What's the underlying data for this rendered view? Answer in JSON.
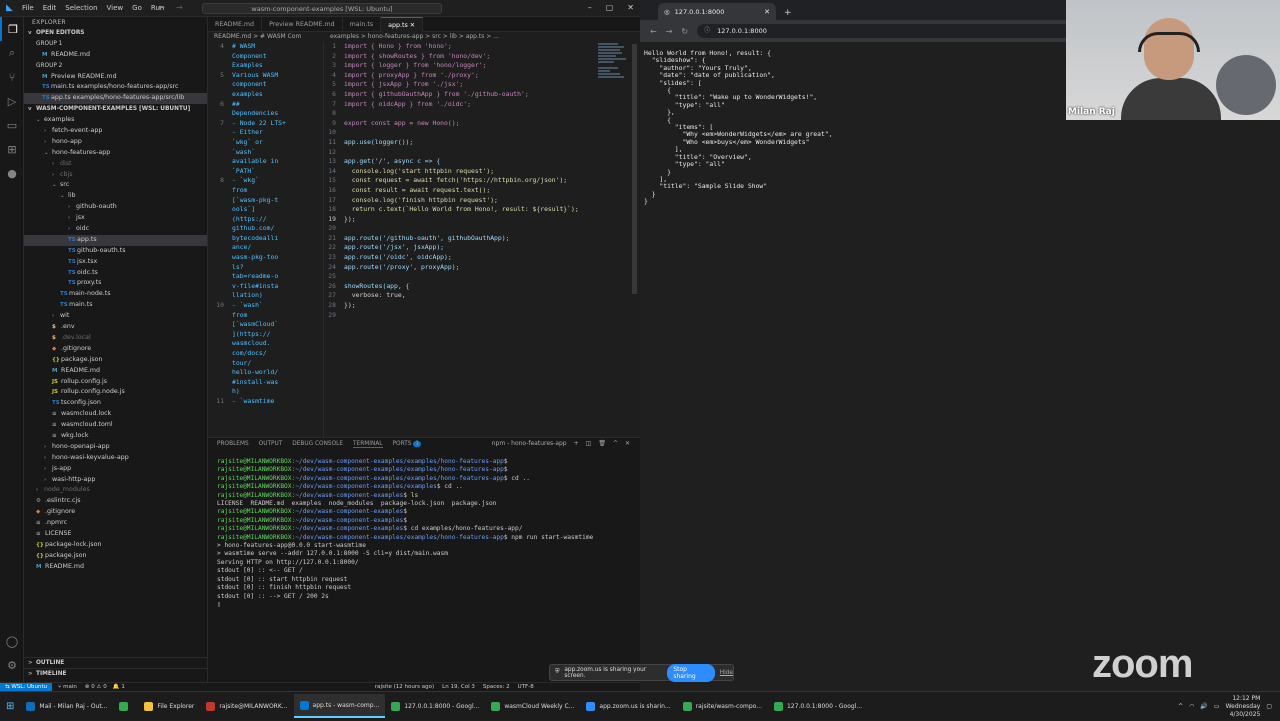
{
  "vscode": {
    "menu": [
      "File",
      "Edit",
      "Selection",
      "View",
      "Go",
      "Run"
    ],
    "command_center": "wasm-component-examples [WSL: Ubuntu]",
    "explorer": {
      "title": "EXPLORER",
      "open_editors": "OPEN EDITORS",
      "group1": "GROUP 1",
      "group1_items": [
        "README.md"
      ],
      "group2": "GROUP 2",
      "group2_items": [
        "Preview README.md",
        "main.ts examples/hono-features-app/src",
        "app.ts examples/hono-features-app/src/lib"
      ],
      "root": "WASM-COMPONENT-EXAMPLES [WSL: UBUNTU]",
      "tree": [
        {
          "indent": 1,
          "twisty": "v",
          "label": "examples"
        },
        {
          "indent": 2,
          "twisty": ">",
          "label": "fetch-event-app"
        },
        {
          "indent": 2,
          "twisty": ">",
          "label": "hono-app"
        },
        {
          "indent": 2,
          "twisty": "v",
          "label": "hono-features-app"
        },
        {
          "indent": 3,
          "twisty": ">",
          "label": "dist",
          "dim": true
        },
        {
          "indent": 3,
          "twisty": ">",
          "label": "cbjs",
          "dim": true
        },
        {
          "indent": 3,
          "twisty": "v",
          "label": "src"
        },
        {
          "indent": 4,
          "twisty": "v",
          "label": "lib"
        },
        {
          "indent": 5,
          "twisty": ">",
          "label": "github-oauth"
        },
        {
          "indent": 5,
          "twisty": ">",
          "label": "jsx"
        },
        {
          "indent": 5,
          "twisty": ">",
          "label": "oidc"
        },
        {
          "indent": 5,
          "file": "TS",
          "label": "app.ts",
          "selected": true
        },
        {
          "indent": 5,
          "file": "TS",
          "label": "github-oauth.ts"
        },
        {
          "indent": 5,
          "file": "TS",
          "label": "jsx.tsx"
        },
        {
          "indent": 5,
          "file": "TS",
          "label": "oidc.ts"
        },
        {
          "indent": 5,
          "file": "TS",
          "label": "proxy.ts"
        },
        {
          "indent": 4,
          "file": "TS",
          "label": "main-node.ts"
        },
        {
          "indent": 4,
          "file": "TS",
          "label": "main.ts"
        },
        {
          "indent": 3,
          "twisty": ">",
          "label": "wit"
        },
        {
          "indent": 3,
          "file": "$",
          "label": ".env"
        },
        {
          "indent": 3,
          "file": "$",
          "label": ".dev.local",
          "dim": true
        },
        {
          "indent": 3,
          "file": "◆",
          "label": ".gitignore"
        },
        {
          "indent": 3,
          "file": "{}",
          "label": "package.json"
        },
        {
          "indent": 3,
          "file": "M",
          "label": "README.md"
        },
        {
          "indent": 3,
          "file": "JS",
          "label": "rollup.config.js"
        },
        {
          "indent": 3,
          "file": "JS",
          "label": "rollup.config.node.js"
        },
        {
          "indent": 3,
          "file": "TS",
          "label": "tsconfig.json"
        },
        {
          "indent": 3,
          "file": "≡",
          "label": "wasmcloud.lock"
        },
        {
          "indent": 3,
          "file": "≡",
          "label": "wasmcloud.toml"
        },
        {
          "indent": 3,
          "file": "≡",
          "label": "wkg.lock"
        },
        {
          "indent": 2,
          "twisty": ">",
          "label": "hono-openapi-app"
        },
        {
          "indent": 2,
          "twisty": ">",
          "label": "hono-wasi-keyvalue-app"
        },
        {
          "indent": 2,
          "twisty": ">",
          "label": "js-app"
        },
        {
          "indent": 2,
          "twisty": ">",
          "label": "wasi-http-app"
        },
        {
          "indent": 1,
          "twisty": ">",
          "label": "node_modules",
          "dim": true
        },
        {
          "indent": 1,
          "file": "⚙",
          "label": ".eslintrc.cjs"
        },
        {
          "indent": 1,
          "file": "◆",
          "label": ".gitignore"
        },
        {
          "indent": 1,
          "file": "≡",
          "label": ".npmrc"
        },
        {
          "indent": 1,
          "file": "≡",
          "label": "LICENSE"
        },
        {
          "indent": 1,
          "file": "{}",
          "label": "package-lock.json"
        },
        {
          "indent": 1,
          "file": "{}",
          "label": "package.json"
        },
        {
          "indent": 1,
          "file": "M",
          "label": "README.md"
        }
      ],
      "outline": "OUTLINE",
      "timeline": "TIMELINE"
    },
    "tabs": [
      "README.md",
      "Preview README.md",
      "main.ts",
      "app.ts"
    ],
    "breadcrumb_left": "README.md > # WASM Com",
    "breadcrumb_right": "examples > hono-features-app > src > lib > app.ts > ...",
    "preview_lines": [
      {
        "ln": "4",
        "tx": "# WASM"
      },
      {
        "ln": "",
        "tx": "Component"
      },
      {
        "ln": "",
        "tx": "Examples"
      },
      {
        "ln": "",
        "tx": ""
      },
      {
        "ln": "5",
        "tx": "Various WASM"
      },
      {
        "ln": "",
        "tx": "component"
      },
      {
        "ln": "",
        "tx": "examples"
      },
      {
        "ln": "",
        "tx": ""
      },
      {
        "ln": "6",
        "tx": "##"
      },
      {
        "ln": "",
        "tx": "Dependencies"
      },
      {
        "ln": "",
        "tx": ""
      },
      {
        "ln": "7",
        "tx": "- Node 22 LTS+"
      },
      {
        "ln": "",
        "tx": "- Either"
      },
      {
        "ln": "",
        "tx": "`wkg` or"
      },
      {
        "ln": "",
        "tx": "`wash`"
      },
      {
        "ln": "",
        "tx": "available in"
      },
      {
        "ln": "",
        "tx": "`PATH`"
      },
      {
        "ln": "8",
        "tx": "  - `wkg`"
      },
      {
        "ln": "",
        "tx": "  from"
      },
      {
        "ln": "",
        "tx": "  [`wasm-pkg-t"
      },
      {
        "ln": "",
        "tx": "  ools`]"
      },
      {
        "ln": "",
        "tx": "  (https://"
      },
      {
        "ln": "",
        "tx": "  github.com/"
      },
      {
        "ln": "",
        "tx": "  bytecodealli"
      },
      {
        "ln": "",
        "tx": "  ance/"
      },
      {
        "ln": "",
        "tx": "  wasm-pkg-too"
      },
      {
        "ln": "",
        "tx": "  ls?"
      },
      {
        "ln": "",
        "tx": "  tab=readme-o"
      },
      {
        "ln": "",
        "tx": "  v-file#insta"
      },
      {
        "ln": "",
        "tx": "  llation)"
      },
      {
        "ln": "10",
        "tx": "  - `wash`"
      },
      {
        "ln": "",
        "tx": "  from"
      },
      {
        "ln": "",
        "tx": "  [`wasmCloud`"
      },
      {
        "ln": "",
        "tx": "  ](https://"
      },
      {
        "ln": "",
        "tx": "  wasmcloud."
      },
      {
        "ln": "",
        "tx": "  com/docs/"
      },
      {
        "ln": "",
        "tx": "  tour/"
      },
      {
        "ln": "",
        "tx": "  hello-world/"
      },
      {
        "ln": "",
        "tx": "  #install-was"
      },
      {
        "ln": "",
        "tx": "  h)"
      },
      {
        "ln": "11",
        "tx": "  - `wasmtime"
      }
    ],
    "code_lines": [
      {
        "ln": "1",
        "tx": "import { Hono } from 'hono';"
      },
      {
        "ln": "2",
        "tx": "import { showRoutes } from 'hono/dev';"
      },
      {
        "ln": "3",
        "tx": "import { logger } from 'hono/logger';"
      },
      {
        "ln": "4",
        "tx": "import { proxyApp } from './proxy';"
      },
      {
        "ln": "5",
        "tx": "import { jsxApp } from './jsx';"
      },
      {
        "ln": "6",
        "tx": "import { githubOauthApp } from './github-oauth';"
      },
      {
        "ln": "7",
        "tx": "import { oidcApp } from './oidc';"
      },
      {
        "ln": "8",
        "tx": ""
      },
      {
        "ln": "9",
        "tx": "export const app = new Hono();"
      },
      {
        "ln": "10",
        "tx": ""
      },
      {
        "ln": "11",
        "tx": "app.use(logger());"
      },
      {
        "ln": "12",
        "tx": ""
      },
      {
        "ln": "13",
        "tx": "app.get('/', async c => {"
      },
      {
        "ln": "14",
        "tx": "  console.log('start httpbin request');"
      },
      {
        "ln": "15",
        "tx": "  const request = await fetch('https://httpbin.org/json');"
      },
      {
        "ln": "16",
        "tx": "  const result = await request.text();"
      },
      {
        "ln": "17",
        "tx": "  console.log('finish httpbin request');"
      },
      {
        "ln": "18",
        "tx": "  return c.text(`Hello World from Hono!, result: ${result}`);"
      },
      {
        "ln": "19",
        "tx": "});"
      },
      {
        "ln": "20",
        "tx": ""
      },
      {
        "ln": "21",
        "tx": "app.route('/github-oauth', githubOauthApp);"
      },
      {
        "ln": "22",
        "tx": "app.route('/jsx', jsxApp);"
      },
      {
        "ln": "23",
        "tx": "app.route('/oidc', oidcApp);"
      },
      {
        "ln": "24",
        "tx": "app.route('/proxy', proxyApp);"
      },
      {
        "ln": "25",
        "tx": ""
      },
      {
        "ln": "26",
        "tx": "showRoutes(app, {"
      },
      {
        "ln": "27",
        "tx": "  verbose: true,"
      },
      {
        "ln": "28",
        "tx": "});"
      },
      {
        "ln": "29",
        "tx": ""
      }
    ],
    "panel_tabs": [
      "PROBLEMS",
      "OUTPUT",
      "DEBUG CONSOLE",
      "TERMINAL",
      "PORTS"
    ],
    "ports_badge": "1",
    "terminal_name": "npm - hono-features-app",
    "terminal_lines": [
      {
        "p": "rajsite@MILANWORKBOX",
        "d": ":~/dev/wasm-component-examples/examples/hono-features-app",
        "c": "$"
      },
      {
        "p": "rajsite@MILANWORKBOX",
        "d": ":~/dev/wasm-component-examples/examples/hono-features-app",
        "c": "$"
      },
      {
        "p": "rajsite@MILANWORKBOX",
        "d": ":~/dev/wasm-component-examples/examples/hono-features-app",
        "c": "$ cd .."
      },
      {
        "p": "rajsite@MILANWORKBOX",
        "d": ":~/dev/wasm-component-examples/examples",
        "c": "$ cd .."
      },
      {
        "p": "rajsite@MILANWORKBOX",
        "d": ":~/dev/wasm-component-examples",
        "c": "$ ls"
      },
      {
        "t": "LICENSE  README.md  examples  node_modules  package-lock.json  package.json"
      },
      {
        "p": "rajsite@MILANWORKBOX",
        "d": ":~/dev/wasm-component-examples",
        "c": "$"
      },
      {
        "p": "rajsite@MILANWORKBOX",
        "d": ":~/dev/wasm-component-examples",
        "c": "$"
      },
      {
        "p": "rajsite@MILANWORKBOX",
        "d": ":~/dev/wasm-component-examples",
        "c": "$ cd examples/hono-features-app/"
      },
      {
        "p": "rajsite@MILANWORKBOX",
        "d": ":~/dev/wasm-component-examples/examples/hono-features-app",
        "c": "$ npm run start-wasmtime"
      },
      {
        "t": ""
      },
      {
        "t": "> hono-features-app@0.0.0 start-wasmtime"
      },
      {
        "t": "> wasmtime serve --addr 127.0.0.1:8000 -S cli=y dist/main.wasm"
      },
      {
        "t": ""
      },
      {
        "t": "Serving HTTP on http://127.0.0.1:8000/"
      },
      {
        "t": "stdout [0] :: <-- GET /"
      },
      {
        "t": "stdout [0] :: start httpbin request"
      },
      {
        "t": "stdout [0] :: finish httpbin request"
      },
      {
        "t": "stdout [0] :: --> GET / 200 2s"
      },
      {
        "t": "▯"
      }
    ],
    "status": {
      "remote": "WSL: Ubuntu",
      "branch": "main",
      "errors": "0",
      "warnings": "0",
      "bell": "1",
      "blame": "rajsite (12 hours ago)",
      "cursor": "Ln 19, Col 3",
      "spaces": "Spaces: 2",
      "enc": "UTF-8"
    }
  },
  "browser": {
    "tab_title": "127.0.0.1:8000",
    "url": "127.0.0.1:8000",
    "body": "Hello World from Hono!, result: {\n  \"slideshow\": {\n    \"author\": \"Yours Truly\",\n    \"date\": \"date of publication\",\n    \"slides\": [\n      {\n        \"title\": \"Wake up to WonderWidgets!\",\n        \"type\": \"all\"\n      },\n      {\n        \"items\": [\n          \"Why <em>WonderWidgets</em> are great\",\n          \"Who <em>buys</em> WonderWidgets\"\n        ],\n        \"title\": \"Overview\",\n        \"type\": \"all\"\n      }\n    ],\n    \"title\": \"Sample Slide Show\"\n  }\n}"
  },
  "zoom": {
    "participant": "Milan Raj",
    "logo": "zoom",
    "share_text": "app.zoom.us is sharing your screen.",
    "stop": "Stop sharing",
    "hide": "Hide"
  },
  "taskbar": {
    "items": [
      {
        "label": "Mail - Milan Raj - Out...",
        "color": "#0f6cbd"
      },
      {
        "label": "",
        "color": "#34a853"
      },
      {
        "label": "File Explorer",
        "color": "#f3c33b"
      },
      {
        "label": "rajsite@MILANWORK...",
        "color": "#c0392b"
      },
      {
        "label": "app.ts - wasm-comp...",
        "color": "#0078d4",
        "active": true
      },
      {
        "label": "127.0.0.1:8000 - Googl...",
        "color": "#34a853"
      },
      {
        "label": "wasmCloud Weekly C...",
        "color": "#34a853"
      },
      {
        "label": "app.zoom.us is sharin...",
        "color": "#2d8cff"
      },
      {
        "label": "rajsite/wasm-compo...",
        "color": "#34a853"
      },
      {
        "label": "127.0.0.1:8000 - Googl...",
        "color": "#34a853"
      }
    ],
    "time": "12:12 PM",
    "day": "Wednesday",
    "date": "4/30/2025"
  }
}
